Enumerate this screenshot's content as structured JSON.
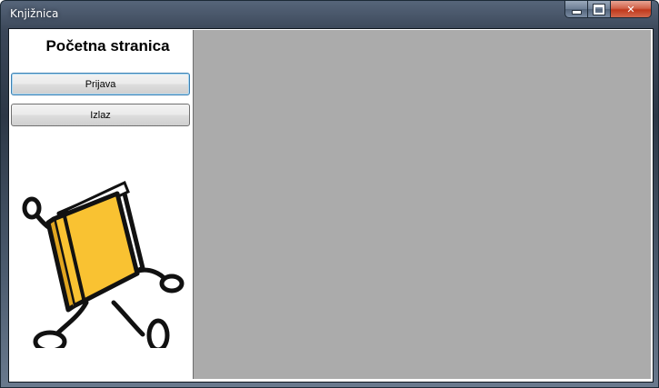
{
  "window": {
    "title": "Knjižnica",
    "controls": {
      "minimize": "minimize",
      "maximize": "maximize",
      "close": "✕"
    }
  },
  "sidebar": {
    "title": "Početna stranica",
    "buttons": {
      "login": "Prijava",
      "exit": "Izlaz"
    },
    "logo_icon": "running-book-icon"
  },
  "colors": {
    "content_background": "#ababab",
    "book_yellow": "#f9c232",
    "close_red": "#c8452a"
  }
}
